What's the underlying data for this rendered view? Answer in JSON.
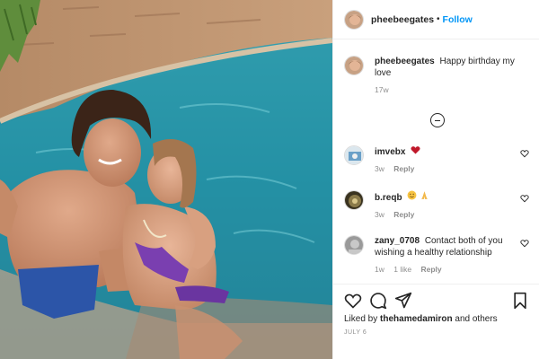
{
  "post": {
    "author": "pheebeegates",
    "follow_label": "Follow",
    "separator": "•",
    "caption": {
      "username": "pheebeegates",
      "text": "Happy birthday my love",
      "time": "17w"
    },
    "load_more_icon": "plus-circle-icon",
    "comments": [
      {
        "username": "imvebx",
        "text": "",
        "emoji": "heart-emoji",
        "time": "3w",
        "likes": "",
        "reply_label": "Reply"
      },
      {
        "username": "b.reqb",
        "text": "",
        "emoji": "smile-pray-emojis",
        "time": "3w",
        "likes": "",
        "reply_label": "Reply"
      },
      {
        "username": "zany_0708",
        "text": "Contact both of you wishing a healthy relationship",
        "time": "1w",
        "likes": "1 like",
        "reply_label": "Reply"
      }
    ],
    "actions": {
      "icons": [
        "heart-icon",
        "comment-icon",
        "share-icon",
        "bookmark-icon"
      ],
      "liked_by_prefix": "Liked by",
      "liked_by_user": "thehamedamiron",
      "liked_by_suffix": "and others",
      "date": "JULY 6"
    }
  },
  "colors": {
    "link_blue": "#0095f6",
    "muted_text": "#8e8e8e",
    "heart_red": "#c0182a",
    "border": "#efefef"
  }
}
